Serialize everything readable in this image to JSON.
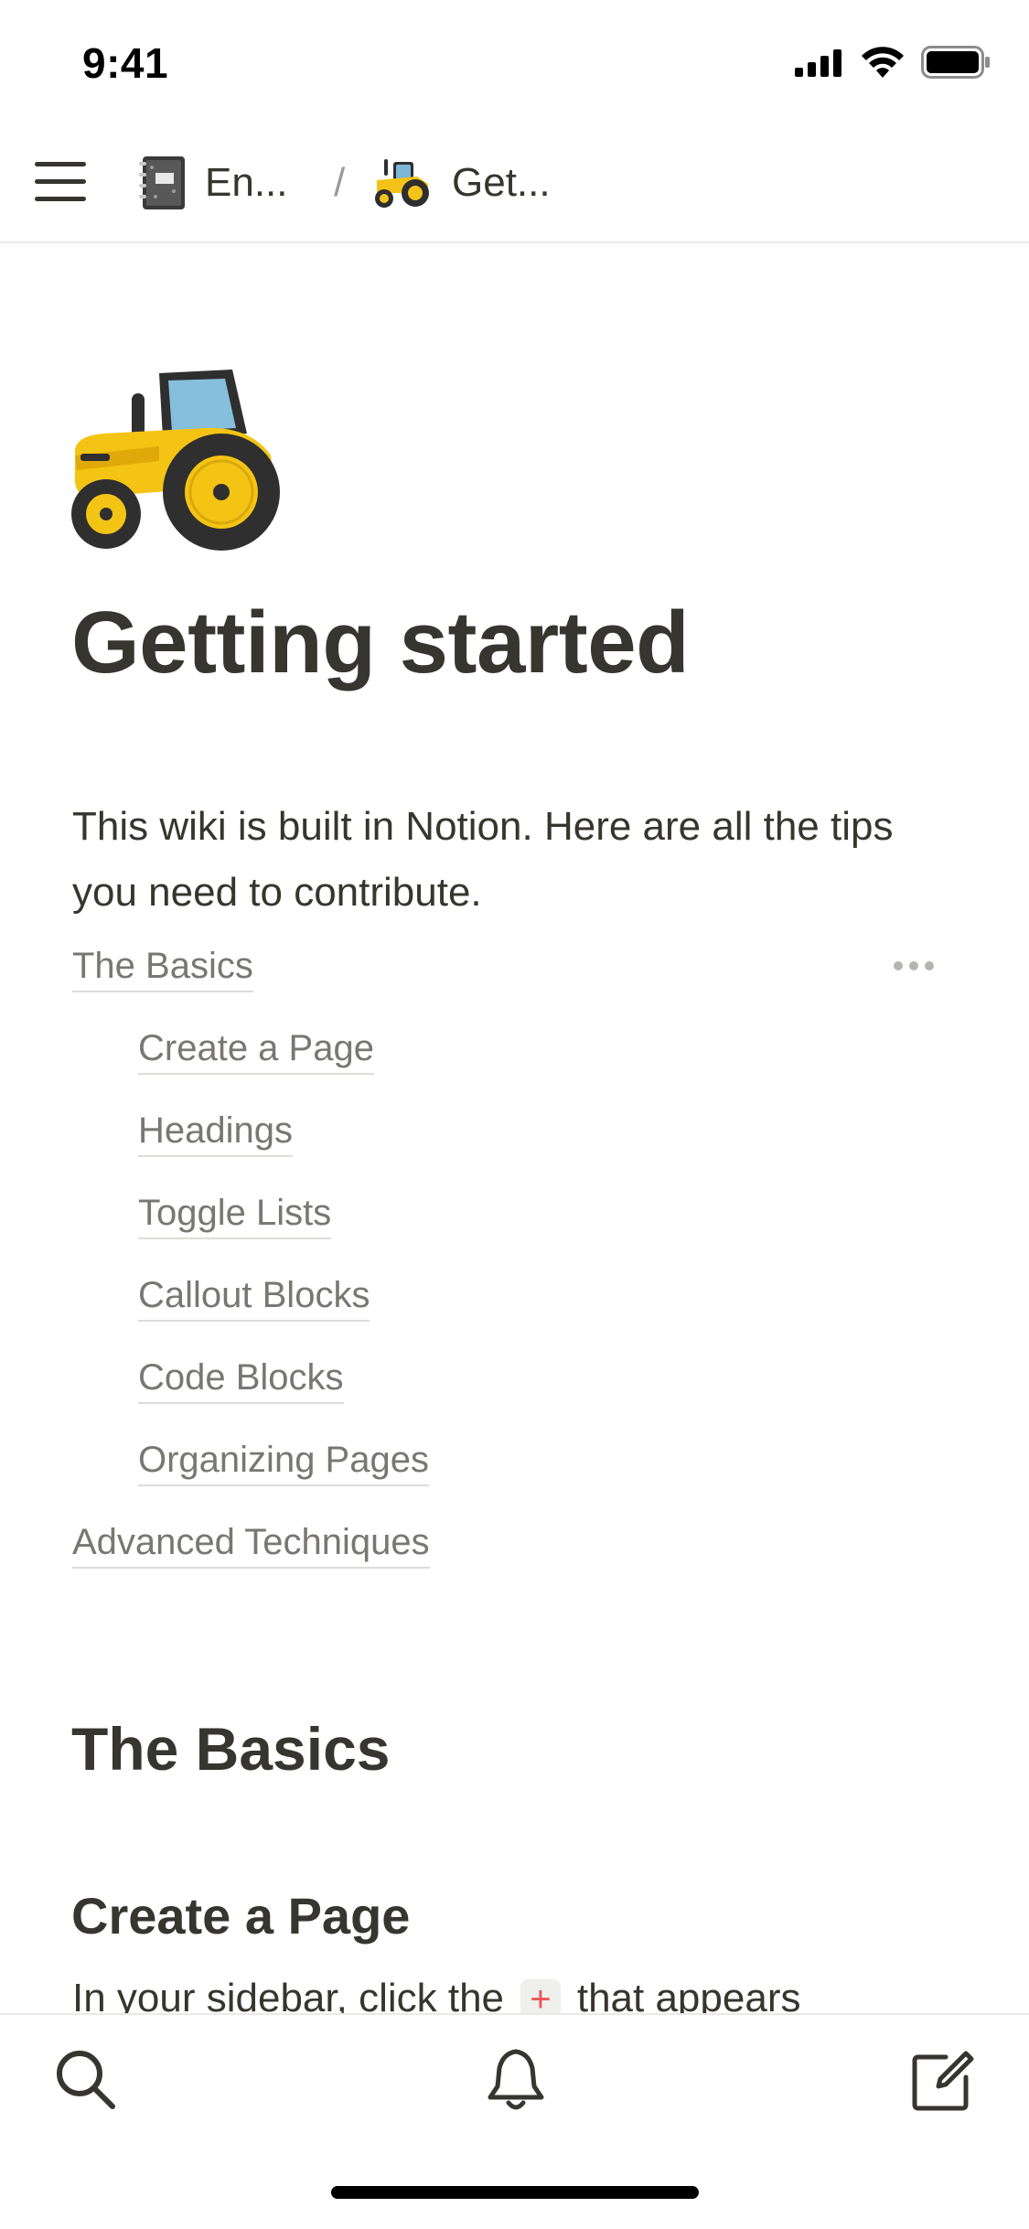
{
  "status_bar": {
    "time": "9:41"
  },
  "breadcrumb": {
    "items": [
      {
        "icon": "notebook-icon",
        "label": "En..."
      },
      {
        "icon": "tractor-icon",
        "label": "Get..."
      }
    ],
    "separator": "/"
  },
  "page": {
    "icon": "tractor-icon",
    "title": "Getting started",
    "intro": "This wiki is built in Notion. Here are all the tips you need to contribute."
  },
  "toc": {
    "items": [
      {
        "label": "The Basics",
        "level": 0
      },
      {
        "label": "Create a Page",
        "level": 1
      },
      {
        "label": "Headings",
        "level": 1
      },
      {
        "label": "Toggle Lists",
        "level": 1
      },
      {
        "label": "Callout Blocks",
        "level": 1
      },
      {
        "label": "Code Blocks",
        "level": 1
      },
      {
        "label": "Organizing Pages",
        "level": 1
      },
      {
        "label": "Advanced Techniques",
        "level": 0
      }
    ]
  },
  "sections": {
    "basics_heading": "The Basics",
    "create_heading": "Create a Page",
    "create_body_before": "In your sidebar, click the",
    "create_body_plus": "+",
    "create_body_after": "that appears"
  },
  "bottom_bar": {
    "items": [
      "search-icon",
      "bell-icon",
      "compose-icon"
    ]
  },
  "colors": {
    "text": "#37352f",
    "muted": "#787774",
    "accent_red": "#eb5757",
    "divider": "#e9e9e7"
  }
}
